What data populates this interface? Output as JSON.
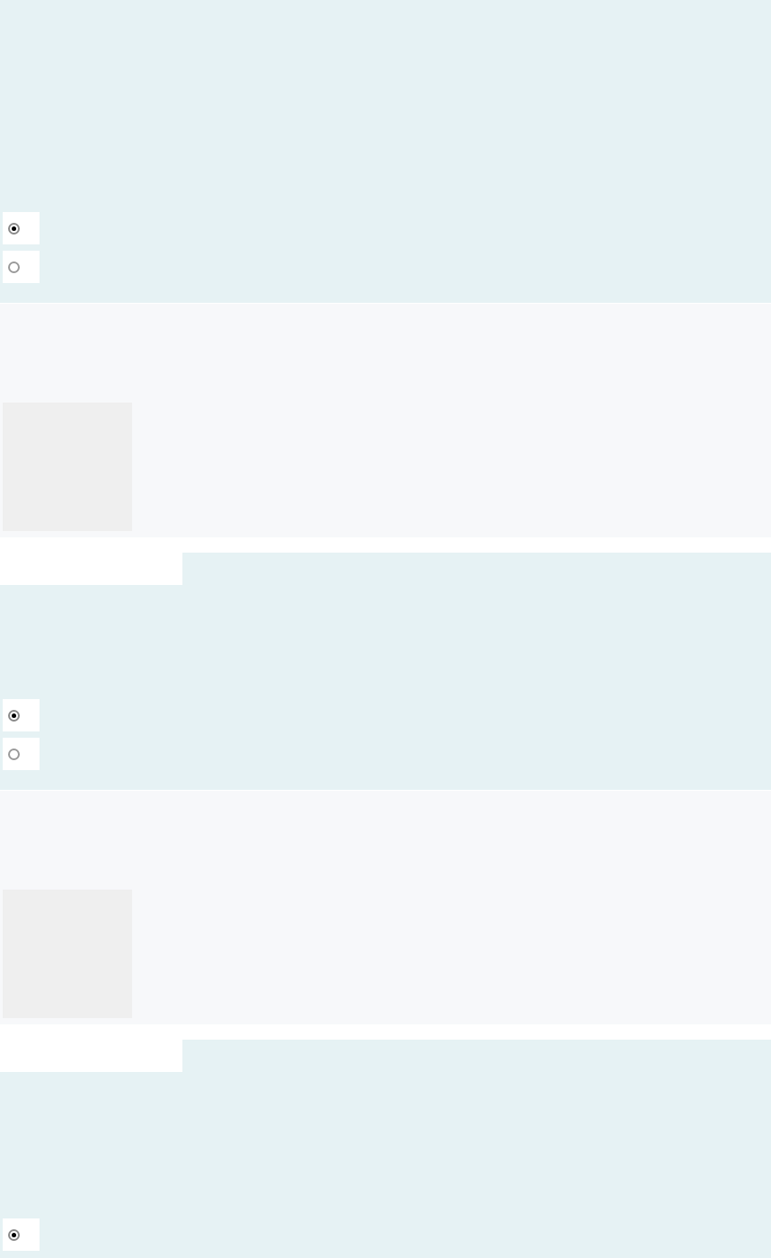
{
  "blocks": [
    {
      "kind": "choice",
      "options": [
        {
          "selected": true
        },
        {
          "selected": false
        }
      ]
    },
    {
      "kind": "image"
    },
    {
      "kind": "choice",
      "options": [
        {
          "selected": true
        },
        {
          "selected": false
        }
      ]
    },
    {
      "kind": "image"
    },
    {
      "kind": "choice",
      "options": [
        {
          "selected": true
        }
      ]
    }
  ]
}
